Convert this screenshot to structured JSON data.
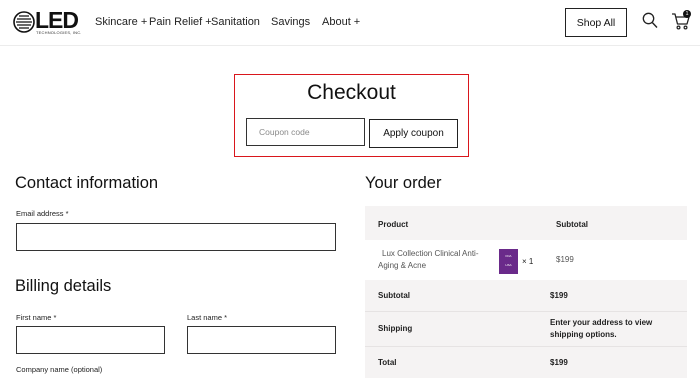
{
  "header": {
    "logo": {
      "word": "LED",
      "subtitle": "TECHNOLOGIES, INC."
    },
    "nav": [
      {
        "label": "Skincare +"
      },
      {
        "label": "Pain Relief +"
      },
      {
        "label": "Sanitation"
      },
      {
        "label": "Savings"
      },
      {
        "label": "About +"
      }
    ],
    "shop_all_label": "Shop All",
    "cart_count": "1"
  },
  "checkout": {
    "title": "Checkout",
    "coupon_placeholder": "Coupon code",
    "coupon_value": "",
    "apply_label": "Apply coupon",
    "highlight_color": "#d9161c"
  },
  "contact": {
    "heading": "Contact information",
    "email_label": "Email address *",
    "email_value": ""
  },
  "billing": {
    "heading": "Billing details",
    "first_name_label": "First name *",
    "last_name_label": "Last name *",
    "company_label": "Company name (optional)"
  },
  "order": {
    "heading": "Your order",
    "col_product": "Product",
    "col_subtotal": "Subtotal",
    "item": {
      "name_line1": "Lux Collection Clinical Anti-",
      "name_line2": "Aging & Acne",
      "thumb_text_1": "FDA",
      "thumb_text_2": "HSA",
      "quantity": "× 1",
      "price": "$199"
    },
    "subtotal_label": "Subtotal",
    "subtotal_value": "$199",
    "shipping_label": "Shipping",
    "shipping_line1": "Enter your address to view",
    "shipping_line2": "shipping options.",
    "total_label": "Total",
    "total_value": "$199"
  },
  "colors": {
    "thumb": "#6a2a8a",
    "table_bg": "#f5f3f3"
  }
}
